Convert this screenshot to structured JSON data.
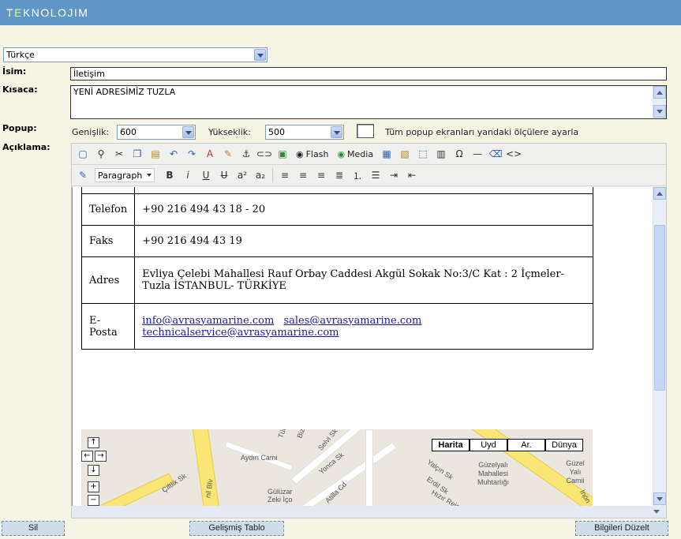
{
  "header": {
    "logo_prefix": "T",
    "logo_accent": "E",
    "logo_rest": "KNOLOJIM"
  },
  "language_select": {
    "value": "Türkçe"
  },
  "labels": {
    "isim": "İsim:",
    "kisaca": "Kısaca:",
    "popup": "Popup:",
    "aciklama": "Açıklama:"
  },
  "form": {
    "isim_value": "İletişim",
    "kisaca_value": "YENİ ADRESİMİZ TUZLA"
  },
  "popup": {
    "width_label": "Genişlik:",
    "width_value": "600",
    "height_label": "Yükseklik:",
    "height_value": "500",
    "checkbox_label": "Tüm popup ekranları yandaki ölçülere ayarla"
  },
  "toolbar": {
    "flash_label": "Flash",
    "media_label": "Media",
    "format_value": "Paragraph"
  },
  "contact_table": [
    {
      "key": "Telefon",
      "value": "+90 216 494 43 18 - 20"
    },
    {
      "key": "Faks",
      "value": "+90 216 494 43 19"
    },
    {
      "key": "Adres",
      "value": "Evliya Çelebi Mahallesi Rauf Orbay Caddesi Akgül Sokak No:3/C Kat : 2 İçmeler-Tuzla İSTANBUL- TÜRKİYE"
    }
  ],
  "email_row": {
    "key": "E-Posta",
    "links": [
      "info@avrasyamarine.com",
      "sales@avrasyamarine.com",
      "technicalservice@avrasyamarine.com"
    ]
  },
  "map": {
    "types": [
      "Harita",
      "Uyd",
      "Ar.",
      "Dünya"
    ],
    "labels": [
      "Aydın Cami",
      "Selvi Sk",
      "Yonca Sk",
      "Atilla Cd",
      "Gülüzar Zeki İço",
      "Çiftlik Sk",
      "Yalçın Sk",
      "Erdil Sk",
      "Hızır Reis",
      "Güzelyalı Mahallesi Muhtarlığı",
      "Güzel Yalı Camii",
      "Tül",
      "Biz",
      "nil Blv",
      "İnön"
    ],
    "nav": {
      "up": "↑",
      "left": "←",
      "right": "→",
      "down": "↓",
      "zoom_in": "+",
      "zoom_out": "−"
    }
  },
  "buttons": {
    "delete": "Sil",
    "advanced_table": "Gelişmiş Tablo",
    "save": "Bilgileri Düzelt"
  }
}
